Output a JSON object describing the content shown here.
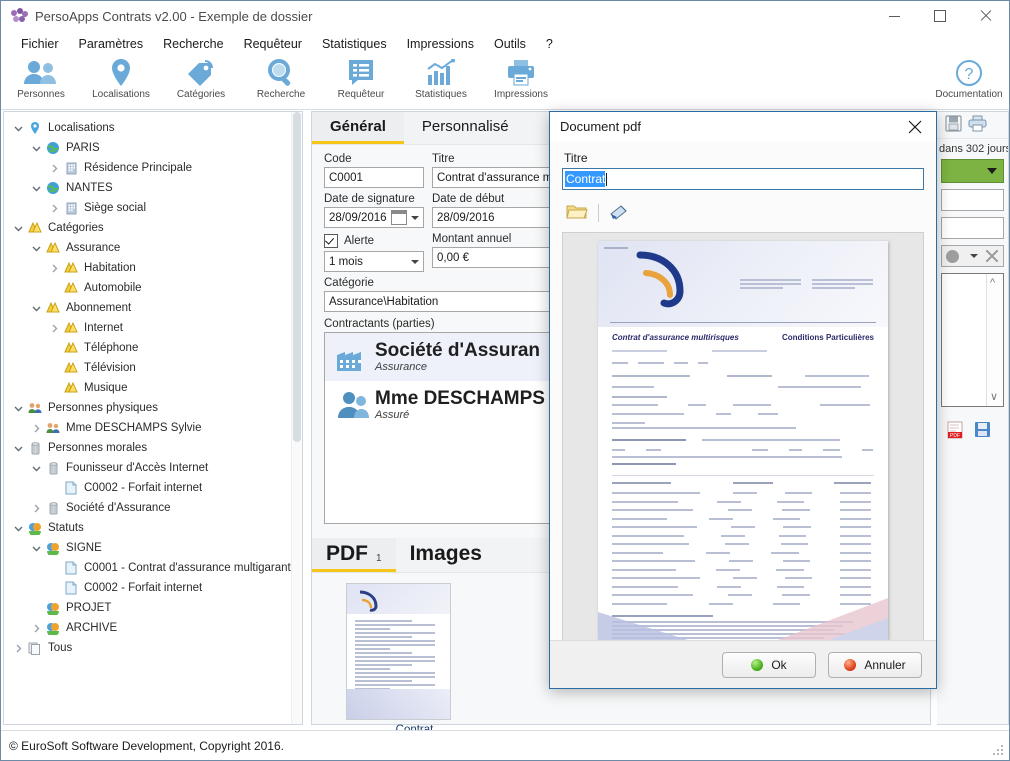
{
  "window": {
    "title": "PersoApps Contrats v2.00 - Exemple de dossier",
    "minimize": "—",
    "maximize": "□",
    "close": "✕"
  },
  "menu": [
    "Fichier",
    "Paramètres",
    "Recherche",
    "Requêteur",
    "Statistiques",
    "Impressions",
    "Outils",
    "?"
  ],
  "ribbon": [
    {
      "label": "Personnes",
      "icon": "people-icon"
    },
    {
      "label": "Localisations",
      "icon": "map-pin-icon"
    },
    {
      "label": "Catégories",
      "icon": "tag-icon"
    },
    {
      "label": "Recherche",
      "icon": "magnifier-icon"
    },
    {
      "label": "Requêteur",
      "icon": "list-icon"
    },
    {
      "label": "Statistiques",
      "icon": "bar-chart-icon"
    },
    {
      "label": "Impressions",
      "icon": "printer-icon"
    },
    {
      "label": "Documentation",
      "icon": "question-circle-icon"
    }
  ],
  "tree": [
    {
      "label": "Localisations",
      "depth": 0,
      "chev": "down",
      "icon": "pin"
    },
    {
      "label": "PARIS",
      "depth": 1,
      "chev": "down",
      "icon": "globe"
    },
    {
      "label": "Résidence Principale",
      "depth": 2,
      "chev": "right",
      "icon": "building"
    },
    {
      "label": "NANTES",
      "depth": 1,
      "chev": "down",
      "icon": "globe"
    },
    {
      "label": "Siège social",
      "depth": 2,
      "chev": "right",
      "icon": "building"
    },
    {
      "label": "Catégories",
      "depth": 0,
      "chev": "down",
      "icon": "cat"
    },
    {
      "label": "Assurance",
      "depth": 1,
      "chev": "down",
      "icon": "cat"
    },
    {
      "label": "Habitation",
      "depth": 2,
      "chev": "right",
      "icon": "cat"
    },
    {
      "label": "Automobile",
      "depth": 2,
      "chev": "none",
      "icon": "cat"
    },
    {
      "label": "Abonnement",
      "depth": 1,
      "chev": "down",
      "icon": "cat"
    },
    {
      "label": "Internet",
      "depth": 2,
      "chev": "right",
      "icon": "cat"
    },
    {
      "label": "Téléphone",
      "depth": 2,
      "chev": "none",
      "icon": "cat"
    },
    {
      "label": "Télévision",
      "depth": 2,
      "chev": "none",
      "icon": "cat"
    },
    {
      "label": "Musique",
      "depth": 2,
      "chev": "none",
      "icon": "cat"
    },
    {
      "label": "Personnes physiques",
      "depth": 0,
      "chev": "down",
      "icon": "people"
    },
    {
      "label": "Mme DESCHAMPS Sylvie",
      "depth": 1,
      "chev": "right",
      "icon": "people"
    },
    {
      "label": "Personnes morales",
      "depth": 0,
      "chev": "down",
      "icon": "tower"
    },
    {
      "label": "Founisseur d'Accès Internet",
      "depth": 1,
      "chev": "down",
      "icon": "tower"
    },
    {
      "label": "C0002 - Forfait internet",
      "depth": 2,
      "chev": "none",
      "icon": "doc"
    },
    {
      "label": "Société d'Assurance",
      "depth": 1,
      "chev": "right",
      "icon": "tower"
    },
    {
      "label": "Statuts",
      "depth": 0,
      "chev": "down",
      "icon": "status"
    },
    {
      "label": "SIGNE",
      "depth": 1,
      "chev": "down",
      "icon": "status"
    },
    {
      "label": "C0001 - Contrat d'assurance multigarantie",
      "depth": 2,
      "chev": "none",
      "icon": "doc"
    },
    {
      "label": "C0002 - Forfait internet",
      "depth": 2,
      "chev": "none",
      "icon": "doc"
    },
    {
      "label": "PROJET",
      "depth": 1,
      "chev": "none",
      "icon": "status"
    },
    {
      "label": "ARCHIVE",
      "depth": 1,
      "chev": "right",
      "icon": "status"
    },
    {
      "label": "Tous",
      "depth": 0,
      "chev": "right",
      "icon": "stack"
    }
  ],
  "center": {
    "tabs": [
      {
        "label": "Général",
        "selected": true
      },
      {
        "label": "Personnalisé",
        "selected": false
      }
    ],
    "fields": {
      "code_label": "Code",
      "code_value": "C0001",
      "titre_label": "Titre",
      "titre_value": "Contrat d'assurance m",
      "date_signature_label": "Date de signature",
      "date_signature_value": "28/09/2016",
      "date_debut_label": "Date de début",
      "date_debut_value": "28/09/2016",
      "alerte_label": "Alerte",
      "alerte_value": "1 mois",
      "montant_label": "Montant annuel",
      "montant_value": "0,00 €",
      "categorie_label": "Catégorie",
      "categorie_value": "Assurance\\Habitation",
      "contractants_label": "Contractants (parties)"
    },
    "parties": [
      {
        "name": "Société d'Assuran",
        "role": "Assurance",
        "icon": "factory-icon",
        "selected": true
      },
      {
        "name": "Mme DESCHAMPS",
        "role": "Assuré",
        "icon": "person-icon",
        "selected": false
      }
    ],
    "doc_tabs": [
      {
        "label": "PDF",
        "count": "1",
        "selected": true
      },
      {
        "label": "Images",
        "count": "",
        "selected": false
      }
    ],
    "thumbnail_caption": "Contrat"
  },
  "right": {
    "save_icon": "save-icon",
    "print_icon": "print-icon",
    "alert_text": "dans 302 jours",
    "status_color": "#7cb342",
    "pdf_icon": "pdf-icon",
    "disk_icon": "save-icon"
  },
  "dialog": {
    "title": "Document pdf",
    "close": "✕",
    "titre_label": "Titre",
    "titre_value": "Contrat",
    "open_icon": "folder-open-icon",
    "scan_icon": "scanner-icon",
    "ok_label": "Ok",
    "cancel_label": "Annuler",
    "preview": {
      "doc_title": "Contrat d'assurance multirisques",
      "doc_subtitle": "Conditions Particulières"
    }
  },
  "status": {
    "text": "© EuroSoft Software Development, Copyright 2016."
  },
  "colors": {
    "accent_yellow": "#f5c518",
    "accent_blue": "#6aa9d8",
    "dialog_border": "#2b6ca3",
    "selection_blue": "#3399ff",
    "green": "#7cb342"
  }
}
